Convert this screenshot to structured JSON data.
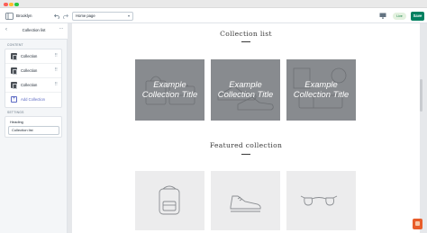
{
  "window": {
    "title": ""
  },
  "topbar": {
    "store_name": "Brooklyn",
    "page_selector": "Home page",
    "live_badge": "Live",
    "save_label": "Save"
  },
  "sidebar": {
    "title": "Collection list",
    "content_label": "CONTENT",
    "items": [
      {
        "label": "Collection"
      },
      {
        "label": "Collection"
      },
      {
        "label": "Collection"
      }
    ],
    "add_label": "Add Collection",
    "settings_label": "SETTINGS",
    "heading_label": "Heading",
    "heading_value": "Collection list"
  },
  "preview": {
    "collection_list_heading": "Collection list",
    "collections": [
      {
        "title": "Example Collection Title"
      },
      {
        "title": "Example Collection Title"
      },
      {
        "title": "Example Collection Title"
      }
    ],
    "featured_heading": "Featured collection",
    "products": [
      {
        "icon": "backpack-icon"
      },
      {
        "icon": "sneaker-icon"
      },
      {
        "icon": "sunglasses-icon"
      }
    ]
  },
  "colors": {
    "accent": "#008060",
    "link": "#5c6ac4",
    "tile_gray": "#888b8f"
  }
}
